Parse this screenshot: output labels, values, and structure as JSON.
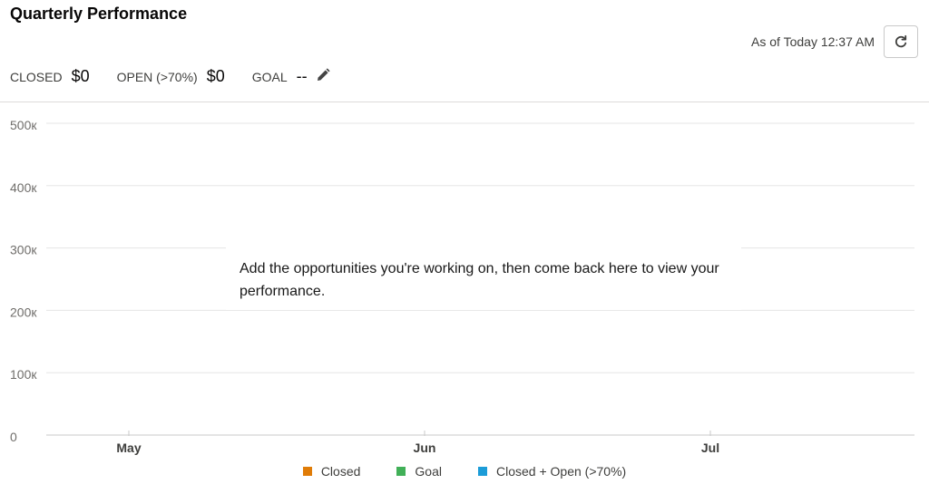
{
  "header": {
    "title": "Quarterly Performance",
    "as_of": "As of Today 12:37 AM",
    "refresh_icon": "refresh-icon"
  },
  "metrics": {
    "closed": {
      "label": "CLOSED",
      "value": "$0"
    },
    "open": {
      "label": "OPEN (>70%)",
      "value": "$0"
    },
    "goal": {
      "label": "GOAL",
      "value": "--",
      "edit_icon": "pencil-icon"
    }
  },
  "empty_message": "Add the opportunities you're working on, then come back here to view your performance.",
  "chart_data": {
    "type": "line",
    "categories": [
      "May",
      "Jun",
      "Jul"
    ],
    "y_ticks": [
      "0",
      "100к",
      "200к",
      "300к",
      "400к",
      "500к"
    ],
    "ylim": [
      0,
      500000
    ],
    "grid": true,
    "legend_placement": "bottom",
    "series": [
      {
        "name": "Closed",
        "color": "#e07c07",
        "values": []
      },
      {
        "name": "Goal",
        "color": "#41b058",
        "values": []
      },
      {
        "name": "Closed + Open (>70%)",
        "color": "#1c9cd8",
        "values": []
      }
    ]
  }
}
